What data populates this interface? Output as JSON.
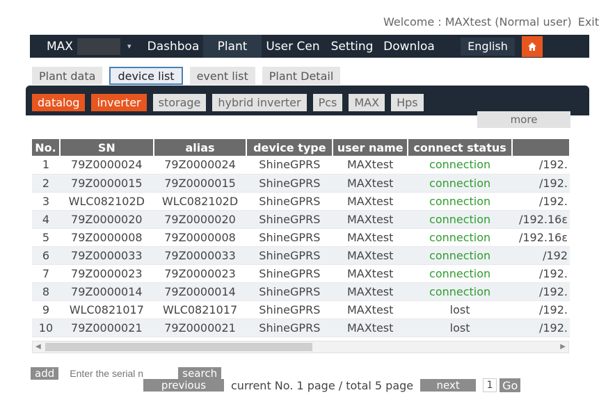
{
  "welcome": {
    "text": "Welcome : MAXtest (Normal user)",
    "exit": "Exit"
  },
  "nav": {
    "user": "MAX",
    "items": [
      "Dashboa",
      "Plant",
      "User Cen",
      "Setting",
      "Downloa"
    ],
    "language": "English",
    "home_icon": "home-icon"
  },
  "plant_tabs": [
    "Plant data",
    "device list",
    "event list",
    "Plant Detail"
  ],
  "device_tabs": [
    "datalog",
    "inverter",
    "storage",
    "hybrid inverter",
    "Pcs",
    "MAX",
    "Hps"
  ],
  "more": "more",
  "table": {
    "headers": [
      "No.",
      "SN",
      "alias",
      "device type",
      "user name",
      "connect status",
      ""
    ],
    "rows": [
      [
        "1",
        "79Z0000024",
        "79Z0000024",
        "ShineGPRS",
        "MAXtest",
        "connection",
        "/192."
      ],
      [
        "2",
        "79Z0000015",
        "79Z0000015",
        "ShineGPRS",
        "MAXtest",
        "connection",
        "/192."
      ],
      [
        "3",
        "WLC082102D",
        "WLC082102D",
        "ShineGPRS",
        "MAXtest",
        "connection",
        "/192."
      ],
      [
        "4",
        "79Z0000020",
        "79Z0000020",
        "ShineGPRS",
        "MAXtest",
        "connection",
        "/192.16ε"
      ],
      [
        "5",
        "79Z0000008",
        "79Z0000008",
        "ShineGPRS",
        "MAXtest",
        "connection",
        "/192.16ε"
      ],
      [
        "6",
        "79Z0000033",
        "79Z0000033",
        "ShineGPRS",
        "MAXtest",
        "connection",
        "/192"
      ],
      [
        "7",
        "79Z0000023",
        "79Z0000023",
        "ShineGPRS",
        "MAXtest",
        "connection",
        "/192."
      ],
      [
        "8",
        "79Z0000014",
        "79Z0000014",
        "ShineGPRS",
        "MAXtest",
        "connection",
        "/192."
      ],
      [
        "9",
        "WLC0821017",
        "WLC0821017",
        "ShineGPRS",
        "MAXtest",
        "lost",
        "/192."
      ],
      [
        "10",
        "79Z0000021",
        "79Z0000021",
        "ShineGPRS",
        "MAXtest",
        "lost",
        "/192."
      ]
    ]
  },
  "bottom": {
    "add": "add",
    "serial_placeholder": "Enter the serial n",
    "search": "search",
    "previous": "previous",
    "pager": "current  No. 1 page / total 5 page",
    "next": "next",
    "page_input": "1",
    "go": "Go"
  },
  "colors": {
    "nav_bg": "#1f2a36",
    "accent": "#e8561f",
    "connected": "#2e9d2e"
  }
}
